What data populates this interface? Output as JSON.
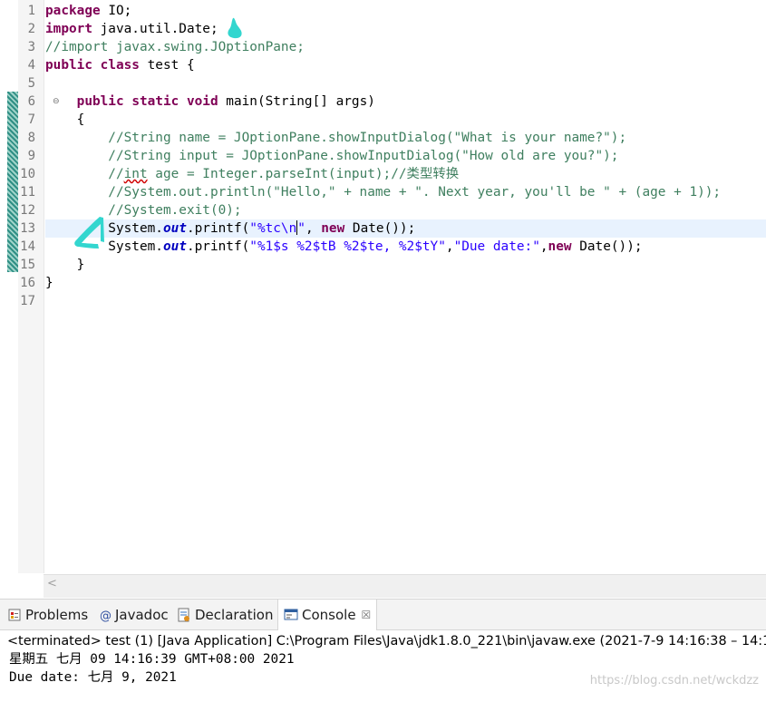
{
  "editor": {
    "line_numbers": [
      "1",
      "2",
      "3",
      "4",
      "5",
      "6",
      "7",
      "8",
      "9",
      "10",
      "11",
      "12",
      "13",
      "14",
      "15",
      "16",
      "17"
    ],
    "fold_marker": "⊖",
    "lines": {
      "l1_kw": "package",
      "l1_rest": " IO;",
      "l2_kw": "import",
      "l2_rest": " java.util.Date;",
      "l3_cm": "//import javax.swing.JOptionPane;",
      "l4_kw1": "public",
      "l4_kw2": "class",
      "l4_rest": " test {",
      "l6_indent": "    ",
      "l6_kw1": "public",
      "l6_kw2": "static",
      "l6_kw3": "void",
      "l6_rest": " main(String[] args)",
      "l7_text": "    {",
      "l8_cm": "        //String name = JOptionPane.showInputDialog(\"What is your name?\");",
      "l9_cm": "        //String input = JOptionPane.showInputDialog(\"How old are you?\");",
      "l10_a": "        //",
      "l10_b": "int",
      "l10_c": " age = Integer.parseInt(input);//类型转换",
      "l11_cm": "        //System.out.println(\"Hello,\" + name + \". Next year, you'll be \" + (age + 1));",
      "l12_cm": "        //System.exit(0);",
      "l13_a": "        System.",
      "l13_field": "out",
      "l13_b": ".printf(",
      "l13_str1": "\"%tc\\n",
      "l13_str2": "\"",
      "l13_c": ", ",
      "l13_kw": "new",
      "l13_d": " Date());",
      "l14_a": "        System.",
      "l14_field": "out",
      "l14_b": ".printf(",
      "l14_str1": "\"%1$s %2$tB %2$te, %2$tY\"",
      "l14_c": ",",
      "l14_str2": "\"Due date:\"",
      "l14_d": ",",
      "l14_kw": "new",
      "l14_e": " Date());",
      "l15_text": "    }",
      "l16_text": "}"
    },
    "scroll_left": "<"
  },
  "console_panel": {
    "tabs": [
      {
        "label": "Problems",
        "icon": "problems-icon"
      },
      {
        "label": "Javadoc",
        "icon": "at-icon"
      },
      {
        "label": "Declaration",
        "icon": "declaration-icon"
      },
      {
        "label": "Console",
        "icon": "console-icon"
      }
    ],
    "close_glyph": "☒",
    "status": "<terminated> test (1) [Java Application] C:\\Program Files\\Java\\jdk1.8.0_221\\bin\\javaw.exe  (2021-7-9 14:16:38 – 14:1",
    "output": [
      "星期五 七月 09 14:16:39 GMT+08:00 2021",
      "Due date: 七月 9, 2021"
    ],
    "watermark": "https://blog.csdn.net/wckdzz"
  },
  "colors": {
    "keyword": "#7f0055",
    "comment": "#3f7f5f",
    "string": "#2a00ff",
    "field": "#0000c0",
    "current_line": "#e8f2fe",
    "annotation_marker": "#33d6cf"
  }
}
